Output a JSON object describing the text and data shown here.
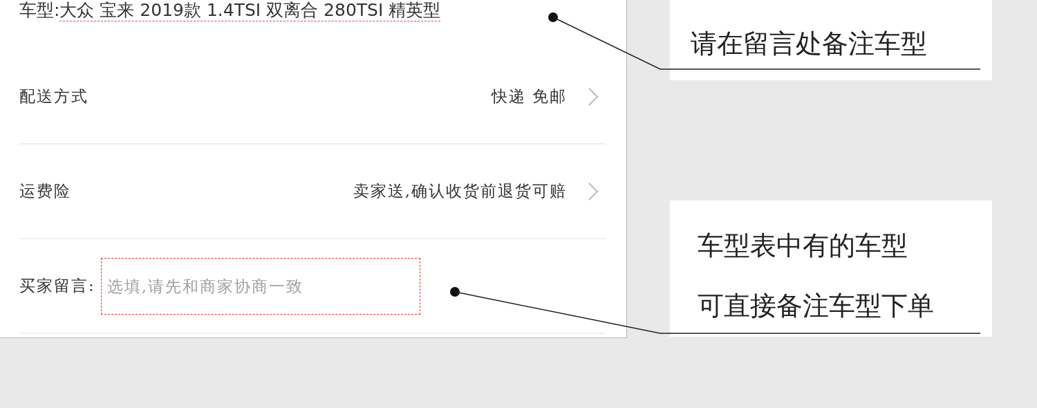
{
  "order_form": {
    "car_model": {
      "label": "车型:",
      "value": "大众 宝来 2019款 1.4TSI 双离合 280TSI 精英型"
    },
    "rows": [
      {
        "kind": "select",
        "label": "配送方式",
        "value": "快递 免邮"
      },
      {
        "kind": "select",
        "label": "运费险",
        "value": "卖家送,确认收货前退货可赔"
      },
      {
        "kind": "input",
        "label": "买家留言:",
        "placeholder": "选填,请先和商家协商一致"
      }
    ]
  },
  "notes": [
    {
      "lines": [
        "请在留言处备注车型"
      ]
    },
    {
      "lines": [
        "车型表中有的车型",
        "可直接备注车型下单"
      ]
    }
  ]
}
